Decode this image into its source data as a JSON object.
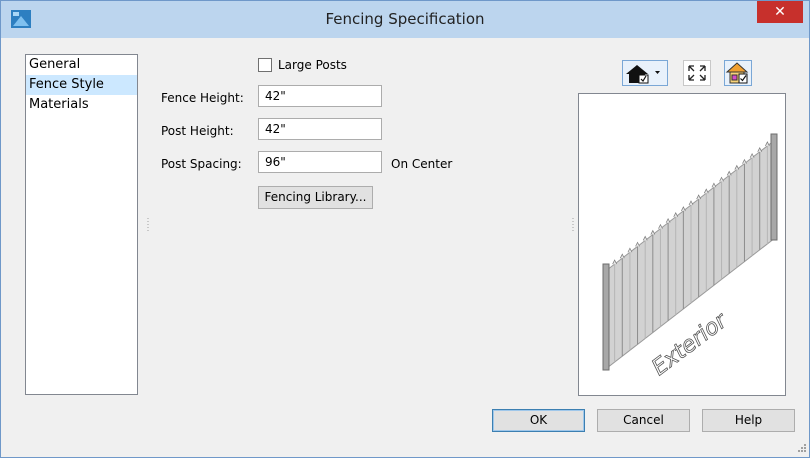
{
  "window": {
    "title": "Fencing Specification",
    "close_glyph": "✕"
  },
  "nav": {
    "items": [
      {
        "label": "General",
        "selected": false
      },
      {
        "label": "Fence Style",
        "selected": true
      },
      {
        "label": "Materials",
        "selected": false
      }
    ]
  },
  "form": {
    "large_posts_label": "Large Posts",
    "large_posts_checked": false,
    "fence_height_label": "Fence Height:",
    "fence_height_value": "42\"",
    "post_height_label": "Post Height:",
    "post_height_value": "42\"",
    "post_spacing_label": "Post Spacing:",
    "post_spacing_value": "96\"",
    "post_spacing_suffix": "On Center",
    "library_button": "Fencing Library..."
  },
  "preview": {
    "toolbar_icons": [
      "camera-view-icon",
      "fill-window-icon",
      "preview-options-icon"
    ],
    "label": "Exterior"
  },
  "footer": {
    "ok": "OK",
    "cancel": "Cancel",
    "help": "Help"
  },
  "colors": {
    "titlebar": "#bcd5ee",
    "close": "#c7302c",
    "selection": "#cce8ff"
  }
}
